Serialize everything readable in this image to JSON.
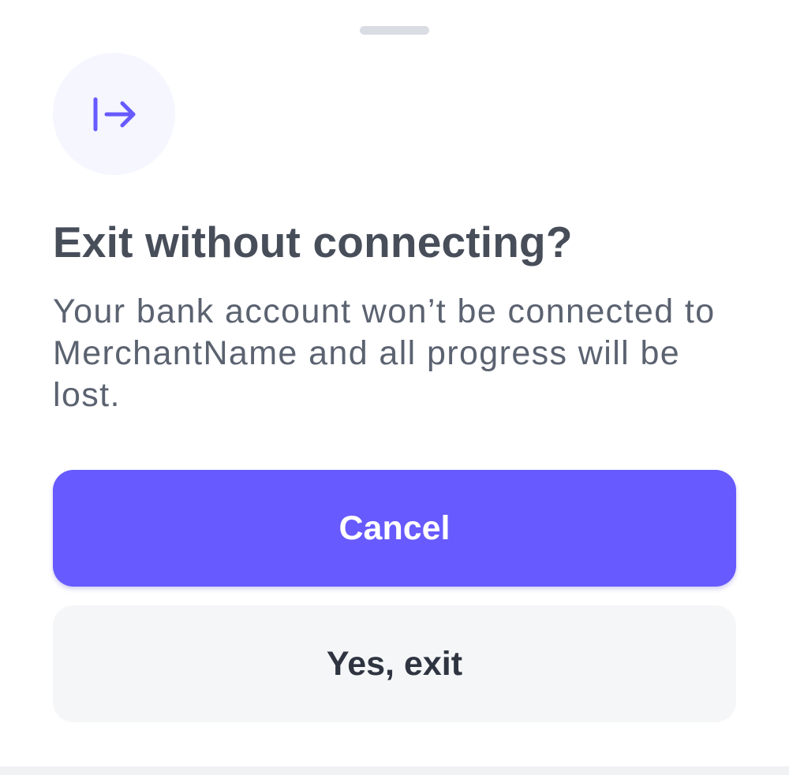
{
  "sheet": {
    "title": "Exit without connecting?",
    "body": "Your bank account won’t be connected to MerchantName and all progress will be lost.",
    "primary_button_label": "Cancel",
    "secondary_button_label": "Yes, exit",
    "icon": "exit-arrow-icon"
  },
  "colors": {
    "accent": "#675afe",
    "icon_circle_bg": "#f5f6fe",
    "title_text": "#474e5a",
    "body_text": "#5b6270",
    "secondary_button_bg": "#f5f6f8",
    "secondary_button_text": "#2e3440",
    "handle": "#d9dde3"
  }
}
